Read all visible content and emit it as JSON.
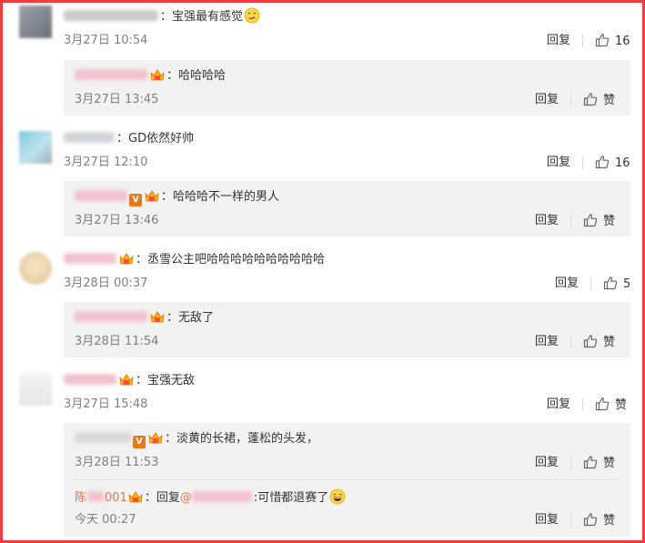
{
  "threads": [
    {
      "comment": {
        "text": "宝强最有感觉",
        "date": "3月27日 10:54",
        "reply": "回复",
        "likes": "16"
      },
      "replies": [
        {
          "text": "哈哈哈哈",
          "date": "3月27日 13:45",
          "reply": "回复",
          "likes": "赞"
        }
      ]
    },
    {
      "comment": {
        "text": "GD依然好帅",
        "date": "3月27日 12:10",
        "reply": "回复",
        "likes": "16"
      },
      "replies": [
        {
          "text": "哈哈哈不一样的男人",
          "date": "3月27日 13:46",
          "reply": "回复",
          "likes": "赞"
        }
      ]
    },
    {
      "comment": {
        "text": "丞雪公主吧哈哈哈哈哈哈哈哈哈哈",
        "date": "3月28日 00:37",
        "reply": "回复",
        "likes": "5"
      },
      "replies": [
        {
          "text": "无敌了",
          "date": "3月28日 11:54",
          "reply": "回复",
          "likes": "赞"
        }
      ]
    },
    {
      "comment": {
        "text": "宝强无敌",
        "date": "3月27日 15:48",
        "reply": "回复",
        "likes": "赞"
      },
      "replies": [
        {
          "text": "淡黄的长裙，蓬松的头发，",
          "date": "3月28日 11:53",
          "reply": "回复",
          "likes": "赞"
        },
        {
          "name_visible": "陈",
          "name_suffix": "001",
          "reply_prefix": "回复",
          "mention_at": "@",
          "text": "可惜都退赛了",
          "date": "今天 00:27",
          "reply": "回复",
          "likes": "赞"
        }
      ]
    }
  ],
  "colors": {
    "border": "#f03c3c",
    "reply_bg": "#f2f2f2",
    "name": "#eb7350",
    "vip_badge": "#e8781a"
  },
  "icons": [
    "thumbs-up-icon",
    "vip-crown-icon",
    "v-badge-icon",
    "smirk-emoji-icon",
    "laugh-emoji-icon"
  ]
}
